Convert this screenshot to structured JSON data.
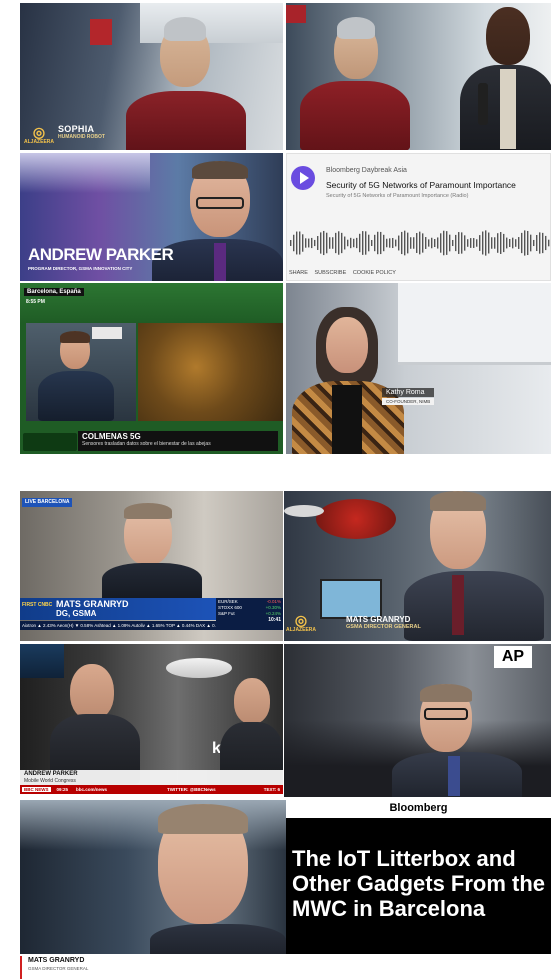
{
  "tiles": {
    "sophia": {
      "name": "SOPHIA",
      "subtitle": "HUMANOID ROBOT",
      "bug": "ALJAZEERA"
    },
    "parker_gsma": {
      "name": "ANDREW PARKER",
      "subtitle": "PROGRAM DIRECTOR, GSMA INNOVATION CITY"
    },
    "bloomberg_player": {
      "show": "Bloomberg Daybreak Asia",
      "title": "Security of 5G Networks of Paramount Importance",
      "subtitle": "Security of 5G Networks of Paramount Importance (Radio)",
      "links": [
        "SHARE",
        "SUBSCRIBE",
        "COOKIE POLICY"
      ],
      "accent": "#6a4ce0"
    },
    "colmenas": {
      "location": "Barcelona, España",
      "time": "8:55 PM",
      "headline": "COLMENAS 5G",
      "caption": "Sensores trasladan datos sobre el bienestar de las abejas"
    },
    "kathy": {
      "name": "Kathy Roma",
      "subtitle": "CO-FOUNDER, NIMB"
    },
    "cnbc": {
      "tag": "LIVE BARCELONA",
      "name": "MATS GRANRYD",
      "title": "DG, GSMA",
      "network": "FIRST CNBC",
      "ticker_right": [
        {
          "label": "EUR/SEK",
          "value": "-0.01%"
        },
        {
          "label": "STOXX 600",
          "value": "+0.30%"
        },
        {
          "label": "S&P Fut",
          "value": "+0.24%"
        }
      ],
      "ticker_bottom": "Aixtron ▲ 2.43%   Aeon(H) ▼ 0.58%   Ashtead ▲ 1.09%   Autoliv ▲ 1.65%   TOP ▲ 0.44%   DAX ▲ 0.50%",
      "clock": "10:41"
    },
    "granryd_ajz": {
      "name": "MATS GRANRYD",
      "subtitle": "GSMA DIRECTOR GENERAL",
      "bug": "ALJAZEERA"
    },
    "bbc": {
      "name": "ANDREW PARKER",
      "subtitle": "Mobile World Congress",
      "network": "BBC NEWS",
      "time": "09:25",
      "ticker": "bbc.com/news",
      "handle": "TWITTER: @BBCNews",
      "right": "TEXT: 6",
      "booth": "kt"
    },
    "ap": {
      "logo": "AP"
    },
    "granryd_live": {
      "name": "MATS GRANRYD",
      "subtitle": "GSMA DIRECTOR GENERAL"
    },
    "bloomberg_headline": {
      "brand": "Bloomberg",
      "headline": "The IoT Litterbox and Other Gadgets From the MWC in Barcelona"
    }
  },
  "colors": {
    "aljazeera_gold": "#f3c24b",
    "cnbc_blue": "#1d53b8",
    "bbc_red": "#b80000",
    "bloomberg_black": "#000000",
    "green_bg": "#1f5c25"
  }
}
